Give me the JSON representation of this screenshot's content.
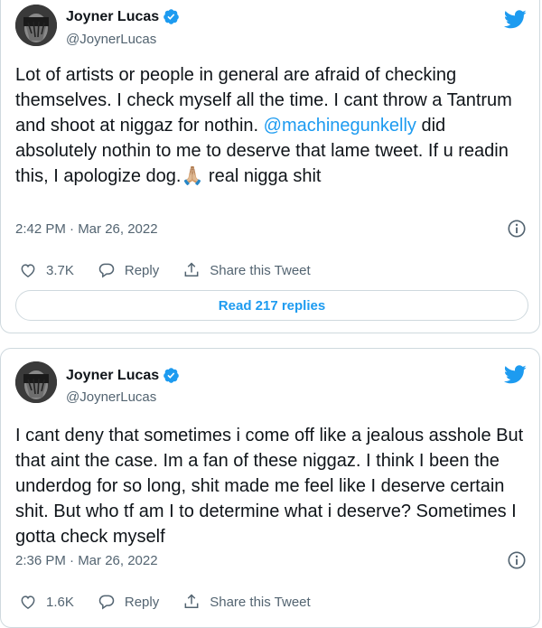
{
  "tweets": [
    {
      "author": "Joyner Lucas",
      "handle": "@JoynerLucas",
      "text_before": "Lot of artists or people in general are afraid of checking themselves. I check myself all the time. I cant throw a Tantrum and shoot at niggaz for nothin. ",
      "mention": "@machinegunkelly",
      "text_after": " did absolutely nothin to me to deserve that lame tweet. If u readin this, I apologize dog.🙏🏼 real nigga shit",
      "timestamp": "2:42 PM · Mar 26, 2022",
      "likes": "3.7K",
      "reply_label": "Reply",
      "share_label": "Share this Tweet",
      "read_replies": "Read 217 replies"
    },
    {
      "author": "Joyner Lucas",
      "handle": "@JoynerLucas",
      "text": "I cant deny that sometimes i come off like a jealous asshole But that aint the case. Im a fan of these niggaz. I think I been the underdog for so long, shit made me feel like I deserve certain shit. But who tf am I to determine what i deserve? Sometimes I gotta check myself",
      "timestamp": "2:36 PM · Mar 26, 2022",
      "likes": "1.6K",
      "reply_label": "Reply",
      "share_label": "Share this Tweet"
    }
  ],
  "colors": {
    "accent": "#1d9bf0",
    "text": "#0f1419",
    "muted": "#536471",
    "border": "#cfd9de"
  }
}
